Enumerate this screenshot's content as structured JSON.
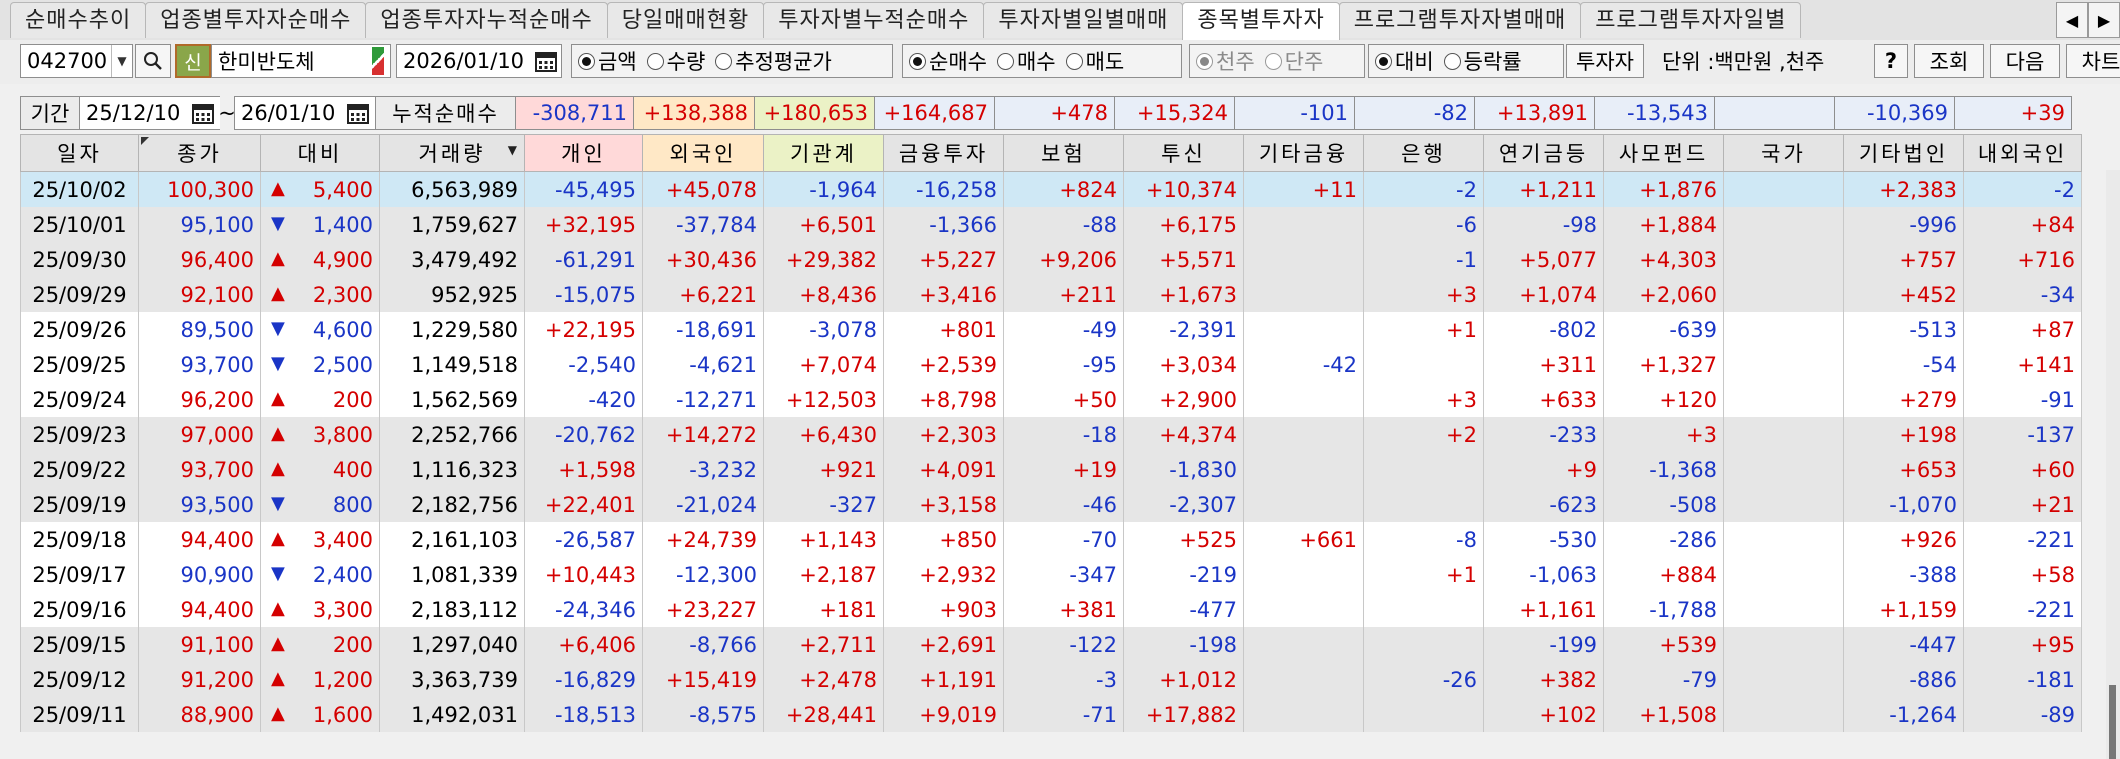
{
  "tabs": [
    {
      "label": "순매수추이",
      "active": false
    },
    {
      "label": "업종별투자자순매수",
      "active": false
    },
    {
      "label": "업종투자자누적순매수",
      "active": false
    },
    {
      "label": "당일매매현황",
      "active": false
    },
    {
      "label": "투자자별누적순매수",
      "active": false
    },
    {
      "label": "투자자별일별매매",
      "active": false
    },
    {
      "label": "종목별투자자",
      "active": true
    },
    {
      "label": "프로그램투자자별매매",
      "active": false
    },
    {
      "label": "프로그램투자자일별",
      "active": false
    }
  ],
  "toolbar": {
    "stock_code": "042700",
    "credit_badge": "신",
    "stock_name": "한미반도체",
    "date": "2026/01/10",
    "metric_options": [
      {
        "label": "금액",
        "selected": true
      },
      {
        "label": "수량",
        "selected": false
      },
      {
        "label": "추정평균가",
        "selected": false
      }
    ],
    "trade_options": [
      {
        "label": "순매수",
        "selected": true
      },
      {
        "label": "매수",
        "selected": false
      },
      {
        "label": "매도",
        "selected": false
      }
    ],
    "unit_options": [
      {
        "label": "천주",
        "selected": true
      },
      {
        "label": "단주",
        "selected": false
      }
    ],
    "compare_options": [
      {
        "label": "대비",
        "selected": true
      },
      {
        "label": "등락률",
        "selected": false
      }
    ],
    "investor_button": "투자자",
    "unit_label": "단위 :백만원 ,천주",
    "help_button": "?",
    "query_button": "조회",
    "next_button": "다음",
    "chart_button": "차트"
  },
  "period": {
    "label": "기간",
    "start": "25/12/10",
    "tilde": "~",
    "end": "26/01/10",
    "cum_label": "누적순매수",
    "cum_values": [
      "-308,711",
      "+138,388",
      "+180,653",
      "+164,687",
      "+478",
      "+15,324",
      "-101",
      "-82",
      "+13,891",
      "-13,543",
      "",
      "-10,369",
      "+39"
    ]
  },
  "columns": [
    "일자",
    "종가",
    "대비",
    "거래량",
    "개인",
    "외국인",
    "기관계",
    "금융투자",
    "보험",
    "투신",
    "기타금융",
    "은행",
    "연기금등",
    "사모펀드",
    "국가",
    "기타법인",
    "내외국인"
  ],
  "rows": [
    [
      "25/10/02",
      "100,300",
      "up",
      "5,400",
      "6,563,989",
      "-45,495",
      "+45,078",
      "-1,964",
      "-16,258",
      "+824",
      "+10,374",
      "+11",
      "-2",
      "+1,211",
      "+1,876",
      "",
      "+2,383",
      "-2"
    ],
    [
      "25/10/01",
      "95,100",
      "dn",
      "1,400",
      "1,759,627",
      "+32,195",
      "-37,784",
      "+6,501",
      "-1,366",
      "-88",
      "+6,175",
      "",
      "-6",
      "-98",
      "+1,884",
      "",
      "-996",
      "+84"
    ],
    [
      "25/09/30",
      "96,400",
      "up",
      "4,900",
      "3,479,492",
      "-61,291",
      "+30,436",
      "+29,382",
      "+5,227",
      "+9,206",
      "+5,571",
      "",
      "-1",
      "+5,077",
      "+4,303",
      "",
      "+757",
      "+716"
    ],
    [
      "25/09/29",
      "92,100",
      "up",
      "2,300",
      "952,925",
      "-15,075",
      "+6,221",
      "+8,436",
      "+3,416",
      "+211",
      "+1,673",
      "",
      "+3",
      "+1,074",
      "+2,060",
      "",
      "+452",
      "-34"
    ],
    [
      "25/09/26",
      "89,500",
      "dn",
      "4,600",
      "1,229,580",
      "+22,195",
      "-18,691",
      "-3,078",
      "+801",
      "-49",
      "-2,391",
      "",
      "+1",
      "-802",
      "-639",
      "",
      "-513",
      "+87"
    ],
    [
      "25/09/25",
      "93,700",
      "dn",
      "2,500",
      "1,149,518",
      "-2,540",
      "-4,621",
      "+7,074",
      "+2,539",
      "-95",
      "+3,034",
      "-42",
      "",
      "+311",
      "+1,327",
      "",
      "-54",
      "+141"
    ],
    [
      "25/09/24",
      "96,200",
      "up",
      "200",
      "1,562,569",
      "-420",
      "-12,271",
      "+12,503",
      "+8,798",
      "+50",
      "+2,900",
      "",
      "+3",
      "+633",
      "+120",
      "",
      "+279",
      "-91"
    ],
    [
      "25/09/23",
      "97,000",
      "up",
      "3,800",
      "2,252,766",
      "-20,762",
      "+14,272",
      "+6,430",
      "+2,303",
      "-18",
      "+4,374",
      "",
      "+2",
      "-233",
      "+3",
      "",
      "+198",
      "-137"
    ],
    [
      "25/09/22",
      "93,700",
      "up",
      "400",
      "1,116,323",
      "+1,598",
      "-3,232",
      "+921",
      "+4,091",
      "+19",
      "-1,830",
      "",
      "",
      "+9",
      "-1,368",
      "",
      "+653",
      "+60"
    ],
    [
      "25/09/19",
      "93,500",
      "dn",
      "800",
      "2,182,756",
      "+22,401",
      "-21,024",
      "-327",
      "+3,158",
      "-46",
      "-2,307",
      "",
      "",
      "-623",
      "-508",
      "",
      "-1,070",
      "+21"
    ],
    [
      "25/09/18",
      "94,400",
      "up",
      "3,400",
      "2,161,103",
      "-26,587",
      "+24,739",
      "+1,143",
      "+850",
      "-70",
      "+525",
      "+661",
      "-8",
      "-530",
      "-286",
      "",
      "+926",
      "-221"
    ],
    [
      "25/09/17",
      "90,900",
      "dn",
      "2,400",
      "1,081,339",
      "+10,443",
      "-12,300",
      "+2,187",
      "+2,932",
      "-347",
      "-219",
      "",
      "+1",
      "-1,063",
      "+884",
      "",
      "-388",
      "+58"
    ],
    [
      "25/09/16",
      "94,400",
      "up",
      "3,300",
      "2,183,112",
      "-24,346",
      "+23,227",
      "+181",
      "+903",
      "+381",
      "-477",
      "",
      "",
      "+1,161",
      "-1,788",
      "",
      "+1,159",
      "-221"
    ],
    [
      "25/09/15",
      "91,100",
      "up",
      "200",
      "1,297,040",
      "+6,406",
      "-8,766",
      "+2,711",
      "+2,691",
      "-122",
      "-198",
      "",
      "",
      "-199",
      "+539",
      "",
      "-447",
      "+95"
    ],
    [
      "25/09/12",
      "91,200",
      "up",
      "1,200",
      "3,363,739",
      "-16,829",
      "+15,419",
      "+2,478",
      "+1,191",
      "-3",
      "+1,012",
      "",
      "-26",
      "+382",
      "-79",
      "",
      "-886",
      "-181"
    ],
    [
      "25/09/11",
      "88,900",
      "up",
      "1,600",
      "1,492,031",
      "-18,513",
      "-8,575",
      "+28,441",
      "+9,019",
      "-71",
      "+17,882",
      "",
      "",
      "+102",
      "+1,508",
      "",
      "-1,264",
      "-89"
    ]
  ],
  "row_colors": {
    "selected": "#cfe8f5",
    "white": "#ffffff",
    "gray": "#e6e6e6",
    "up": "#d40000",
    "down": "#1a35c6"
  }
}
